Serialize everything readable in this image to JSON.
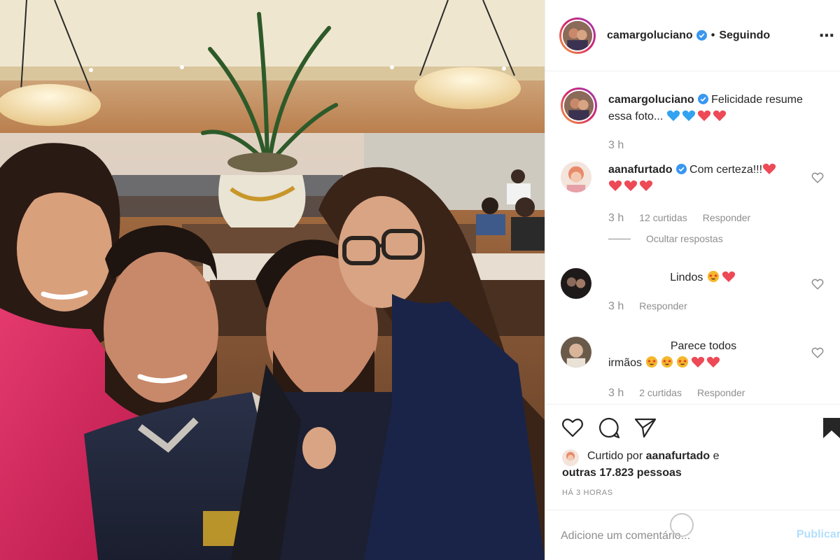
{
  "post": {
    "username": "camargoluciano",
    "follow_status": "Seguindo",
    "more_icon": "more-options-icon"
  },
  "caption": {
    "username": "camargoluciano",
    "text": "Felicidade resume essa foto...",
    "emojis": [
      "blue-heart",
      "blue-heart",
      "red-heart",
      "red-heart"
    ],
    "time": "3 h"
  },
  "comments": [
    {
      "username": "aanafurtado",
      "verified": true,
      "text": "Com certeza!!!",
      "emojis": [
        "red-heart",
        "red-heart",
        "red-heart",
        "red-heart"
      ],
      "time": "3 h",
      "likes": "12 curtidas",
      "reply": "Responder",
      "hide_replies": "Ocultar respostas"
    },
    {
      "text": "Lindos",
      "emojis": [
        "star-eyes",
        "red-heart"
      ],
      "time": "3 h",
      "reply": "Responder"
    },
    {
      "text_line1": "Parece todos",
      "text_line2": "irmãos",
      "emojis": [
        "star-eyes",
        "star-eyes",
        "star-eyes",
        "red-heart",
        "red-heart"
      ],
      "time": "3 h",
      "likes": "2 curtidas",
      "reply": "Responder"
    }
  ],
  "actions": {
    "like_icon": "heart-outline-icon",
    "comment_icon": "comment-icon",
    "share_icon": "share-icon",
    "save_icon": "bookmark-icon"
  },
  "likes": {
    "prefix": "Curtido por",
    "user": "aanafurtado",
    "conjunction": "e",
    "others": "outras 17.823 pessoas"
  },
  "time_ago": "HÁ 3 HORAS",
  "add_comment": {
    "placeholder": "Adicione um comentário...",
    "publish": "Publicar"
  },
  "colors": {
    "verified_blue": "#3897f0",
    "heart_red": "#ed4956",
    "heart_blue": "#32a3f0",
    "publish_disabled": "#b2dffc",
    "muted_gray": "#8e8e8e"
  }
}
